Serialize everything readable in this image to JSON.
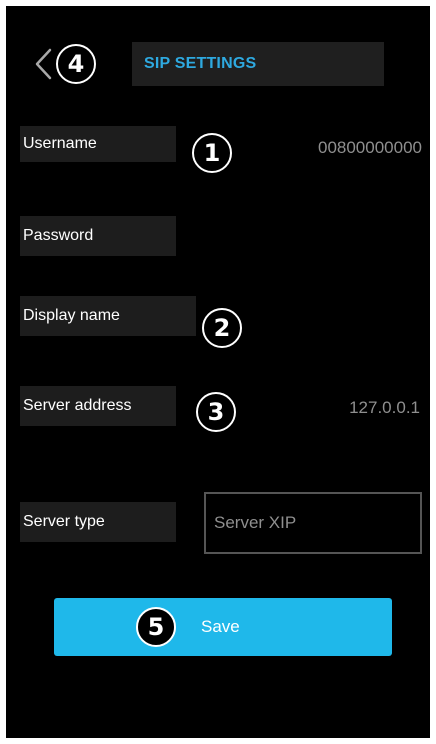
{
  "header": {
    "title": "SIP SETTINGS"
  },
  "fields": {
    "username": {
      "label": "Username",
      "value": "00800000000"
    },
    "password": {
      "label": "Password",
      "value": ""
    },
    "display_name": {
      "label": "Display name",
      "value": ""
    },
    "server_address": {
      "label": "Server address",
      "value": "127.0.0.1"
    },
    "server_type": {
      "label": "Server type",
      "value": "Server XIP"
    }
  },
  "save_button": {
    "label": "Save"
  },
  "badges": {
    "username": "1",
    "display_name": "2",
    "server_address": "3",
    "back": "4",
    "save": "5"
  },
  "colors": {
    "background": "#000000",
    "accent": "#1fb8ea",
    "title": "#2ea9e0",
    "label_box": "#1d1d1d",
    "value_text": "#8f8f8f"
  },
  "icons": {
    "back": "chevron-left-icon"
  }
}
